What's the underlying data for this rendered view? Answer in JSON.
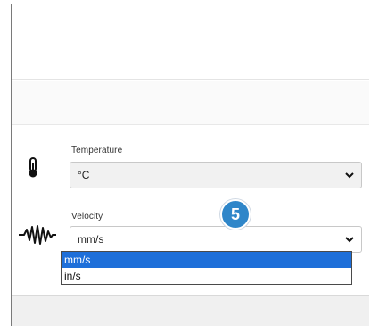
{
  "colors": {
    "badge": "#2f86c9",
    "selected_option": "#1e6fd9"
  },
  "temperature": {
    "label": "Temperature",
    "value": "°C",
    "icon": "thermometer-icon"
  },
  "velocity": {
    "label": "Velocity",
    "value": "mm/s",
    "icon": "vibration-waveform-icon",
    "options": [
      "mm/s",
      "in/s"
    ],
    "selected_index": 0
  },
  "step_badge": {
    "number": "5"
  }
}
